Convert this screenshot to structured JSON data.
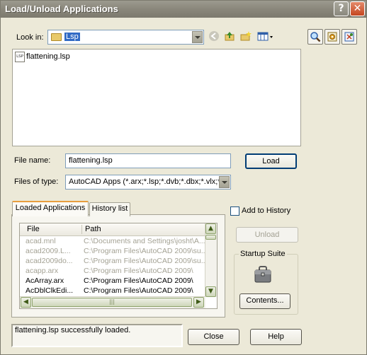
{
  "window": {
    "title": "Load/Unload Applications",
    "help_button": "?",
    "close_button": "✕"
  },
  "browser": {
    "look_in_label": "Look in:",
    "look_in_value": "Lsp",
    "files": [
      {
        "name": "flattening.lsp",
        "icon": "lsp-file-icon"
      }
    ]
  },
  "form": {
    "file_name_label": "File name:",
    "file_name_value": "flattening.lsp",
    "files_of_type_label": "Files of type:",
    "files_of_type_value": "AutoCAD Apps (*.arx;*.lsp;*.dvb;*.dbx;*.vlx;*.",
    "load_button": "Load"
  },
  "tabs": [
    {
      "label": "Loaded Applications",
      "active": true
    },
    {
      "label": "History list",
      "active": false
    }
  ],
  "loaded_apps": {
    "columns": [
      "File",
      "Path"
    ],
    "rows": [
      {
        "file": "acad.mnl",
        "path": "C:\\Documents and Settings\\josht\\A...",
        "grey": true
      },
      {
        "file": "acad2009.L...",
        "path": "C:\\Program Files\\AutoCAD 2009\\su...",
        "grey": true
      },
      {
        "file": "acad2009do...",
        "path": "C:\\Program Files\\AutoCAD 2009\\su...",
        "grey": true
      },
      {
        "file": "acapp.arx",
        "path": "C:\\Program Files\\AutoCAD 2009\\",
        "grey": true
      },
      {
        "file": "AcArray.arx",
        "path": "C:\\Program Files\\AutoCAD 2009\\",
        "grey": false
      },
      {
        "file": "AcDblClkEdi...",
        "path": "C:\\Program Files\\AutoCAD 2009\\",
        "grey": false
      }
    ],
    "hscroll_grip": "|||"
  },
  "options": {
    "add_to_history_label": "Add to History",
    "add_to_history_checked": false,
    "unload_button": "Unload",
    "unload_enabled": false
  },
  "startup_suite": {
    "label": "Startup Suite",
    "icon": "briefcase-icon",
    "contents_button": "Contents..."
  },
  "status": {
    "message": "flattening.lsp successfully loaded."
  },
  "footer": {
    "close_button": "Close",
    "help_button": "Help"
  }
}
